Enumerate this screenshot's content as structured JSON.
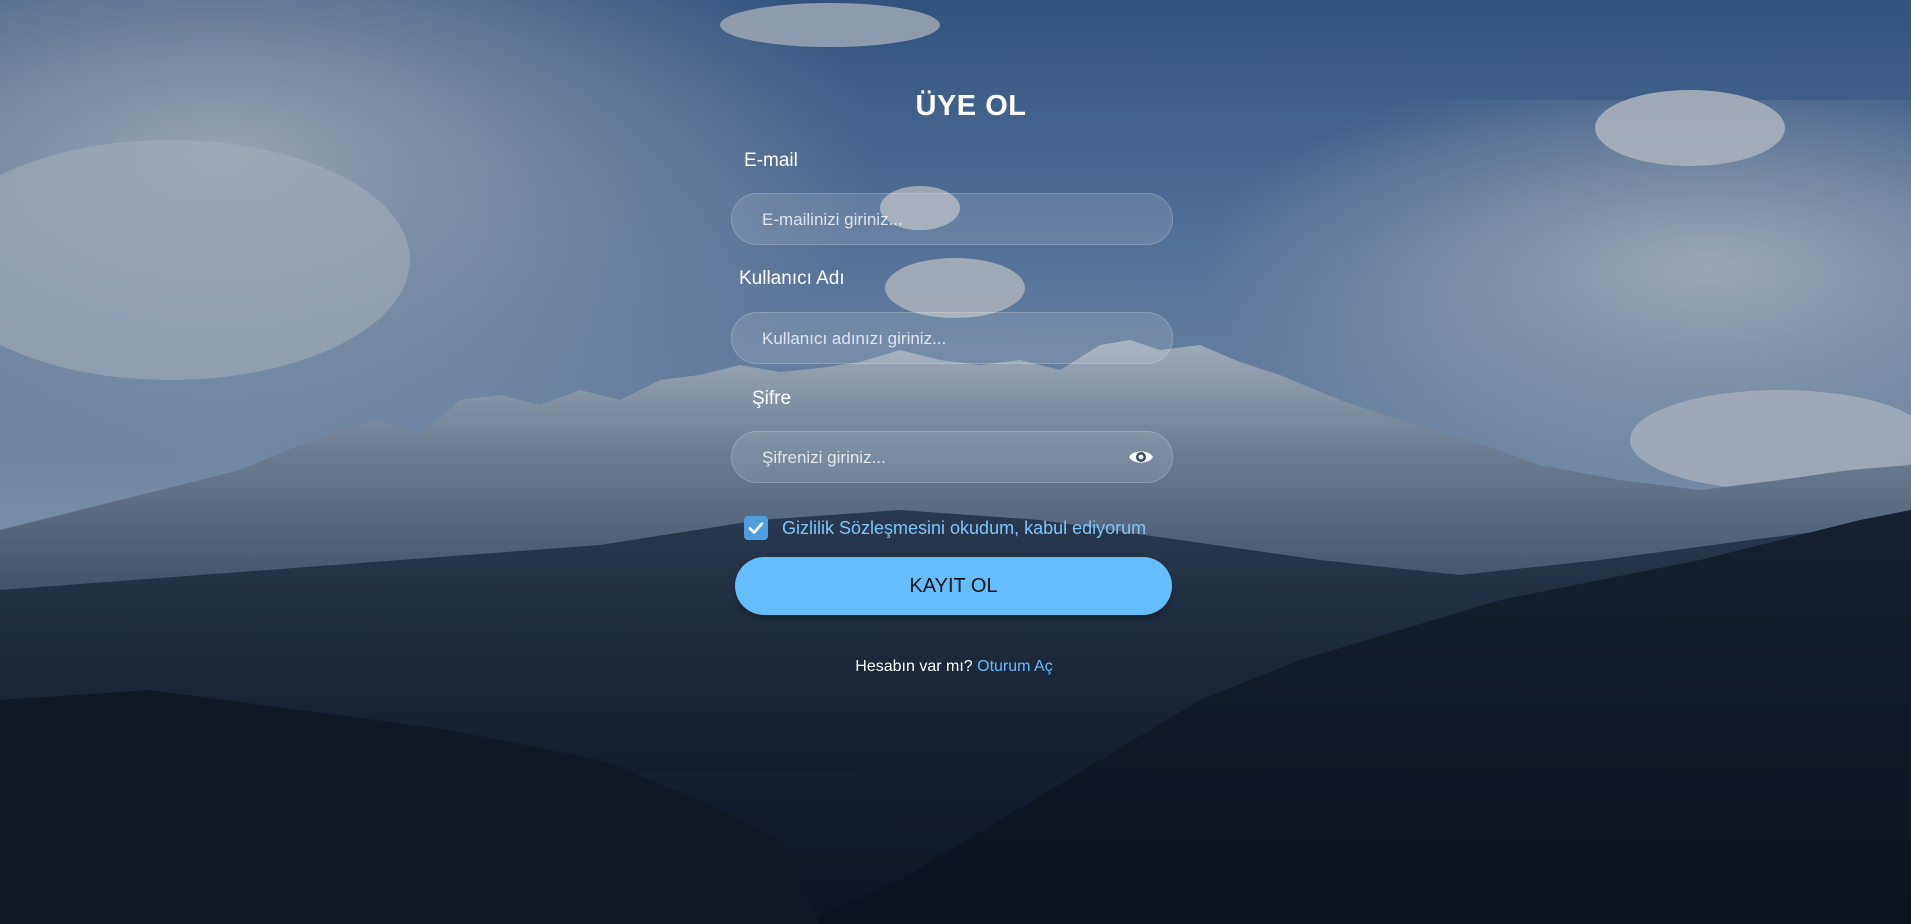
{
  "form": {
    "title": "ÜYE OL",
    "email": {
      "label": "E-mail",
      "placeholder": "E-mailinizi giriniz...",
      "value": ""
    },
    "username": {
      "label": "Kullanıcı Adı",
      "placeholder": "Kullanıcı adınızı giriniz...",
      "value": ""
    },
    "password": {
      "label": "Şifre",
      "placeholder": "Şifrenizi giriniz...",
      "value": "",
      "toggle_icon": "eye-icon"
    },
    "agreement": {
      "checked": true,
      "text": "Gizlilik Sözleşmesini okudum, kabul ediyorum",
      "icon": "checkmark-icon"
    },
    "submit_label": "KAYIT OL",
    "footer": {
      "question": "Hesabın var mı?",
      "link_text": "Oturum Aç"
    }
  },
  "colors": {
    "accent": "#64bdfd",
    "agreement_text": "#7cc7ff",
    "checkbox": "#4f9fe0"
  }
}
